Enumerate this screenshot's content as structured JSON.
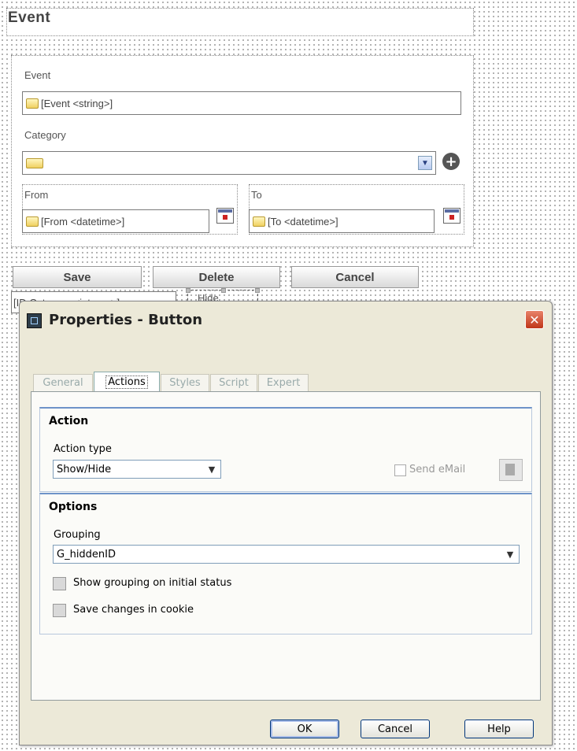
{
  "form": {
    "title": "Event",
    "event_label": "Event",
    "event_field": "[Event <string>]",
    "category_label": "Category",
    "from_label": "From",
    "from_field": "[From <datetime>]",
    "to_label": "To",
    "to_field": "[To <datetime>]",
    "buttons": {
      "save": "Save",
      "delete": "Delete",
      "cancel": "Cancel"
    },
    "id_field": "[ID Category <integer>]",
    "hide_label": "Hide"
  },
  "dialog": {
    "title": "Properties - Button",
    "close_glyph": "✕",
    "tabs": [
      "General",
      "Actions",
      "Styles",
      "Script",
      "Expert"
    ],
    "active_tab": "Actions",
    "action_group": {
      "title": "Action",
      "action_type_label": "Action type",
      "action_type_value": "Show/Hide",
      "send_email_label": "Send eMail"
    },
    "options_group": {
      "title": "Options",
      "grouping_label": "Grouping",
      "grouping_value": "G_hiddenID",
      "show_initial_label": "Show grouping on initial status",
      "save_cookie_label": "Save changes in cookie"
    },
    "buttons": {
      "ok": "OK",
      "cancel": "Cancel",
      "help": "Help"
    }
  },
  "icons": {
    "dropdown": "chevron-down-icon",
    "add": "plus-circle-icon",
    "calendar": "calendar-icon",
    "close": "close-icon"
  }
}
